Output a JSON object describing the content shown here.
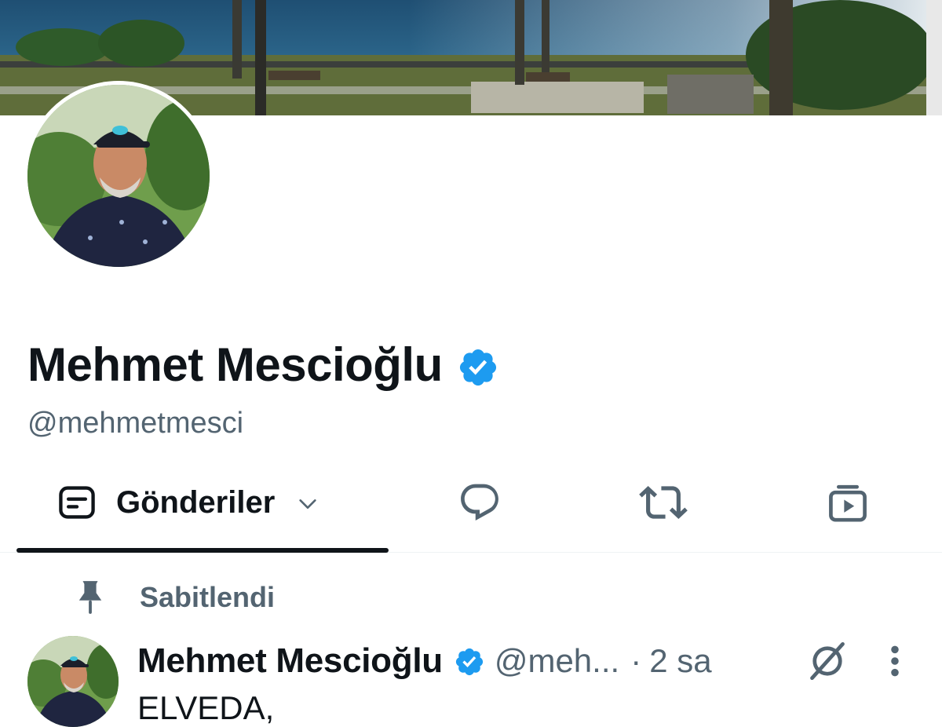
{
  "profile": {
    "display_name": "Mehmet Mescioğlu",
    "handle": "@mehmetmesci",
    "verified": true
  },
  "tabs": [
    {
      "label": "Gönderiler",
      "icon": "posts-icon",
      "selected": true
    },
    {
      "label": "",
      "icon": "reply-bubble-icon"
    },
    {
      "label": "",
      "icon": "repost-icon"
    },
    {
      "label": "",
      "icon": "media-icon"
    }
  ],
  "pinned": {
    "label": "Sabitlendi",
    "icon": "pin-icon"
  },
  "tweet": {
    "author_name": "Mehmet Mescioğlu",
    "author_handle": "@meh...",
    "separator": "·",
    "time": "2 sa",
    "text": "ELVEDA,"
  },
  "colors": {
    "verified_blue": "#1d9bf0",
    "secondary_text": "#536471",
    "primary_text": "#0f1419",
    "tab_indicator": "#0f1419"
  }
}
